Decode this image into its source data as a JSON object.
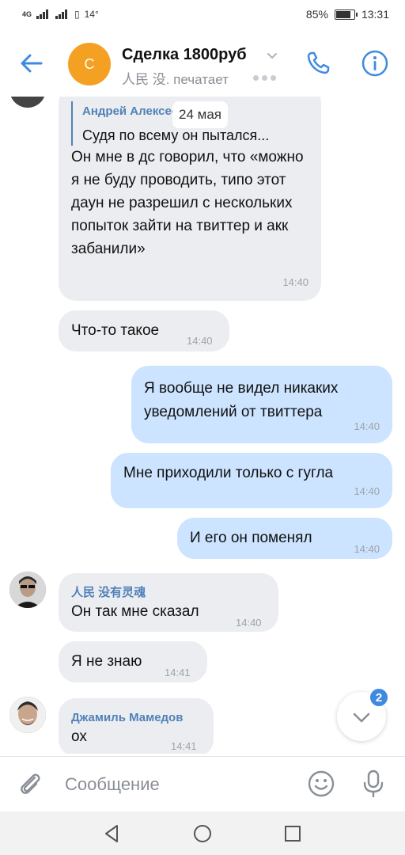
{
  "status_bar": {
    "network": "4G",
    "temperature": "14°",
    "battery_percent": "85%",
    "battery_level": 0.85,
    "time": "13:31"
  },
  "header": {
    "avatar_letter": "С",
    "title": "Сделка 1800руб",
    "subtitle": "人民 没. печатает",
    "avatar_color": "#f4a023",
    "accent_color": "#3f8ae0"
  },
  "messages": {
    "m1": {
      "quote_author": "Андрей Алексеев",
      "quote_date": "24 мая",
      "quote_text": "Судя по всему он пытался...",
      "text": "Он мне в дс говорил, что «можно я не буду проводить, типо этот даун не разрешил с нескольких попыток зайти на твиттер и акк забанили»",
      "time": "14:40"
    },
    "m2": {
      "text": "Что-то такое",
      "time": "14:40"
    },
    "m3": {
      "text": "Я вообще не видел никаких уведомлений от твиттера",
      "time": "14:40"
    },
    "m4": {
      "text": "Мне приходили только с гугла",
      "time": "14:40"
    },
    "m5": {
      "text": "И его он поменял",
      "time": "14:40"
    },
    "m6": {
      "sender": "人民 没有灵魂",
      "text": "Он так мне сказал",
      "time": "14:40"
    },
    "m7": {
      "text": "Я не знаю",
      "time": "14:41"
    },
    "m8": {
      "sender": "Джамиль Мамедов",
      "text": "ох",
      "time": "14:41"
    }
  },
  "scroll_down": {
    "unread_count": "2"
  },
  "composer": {
    "placeholder": "Сообщение"
  }
}
